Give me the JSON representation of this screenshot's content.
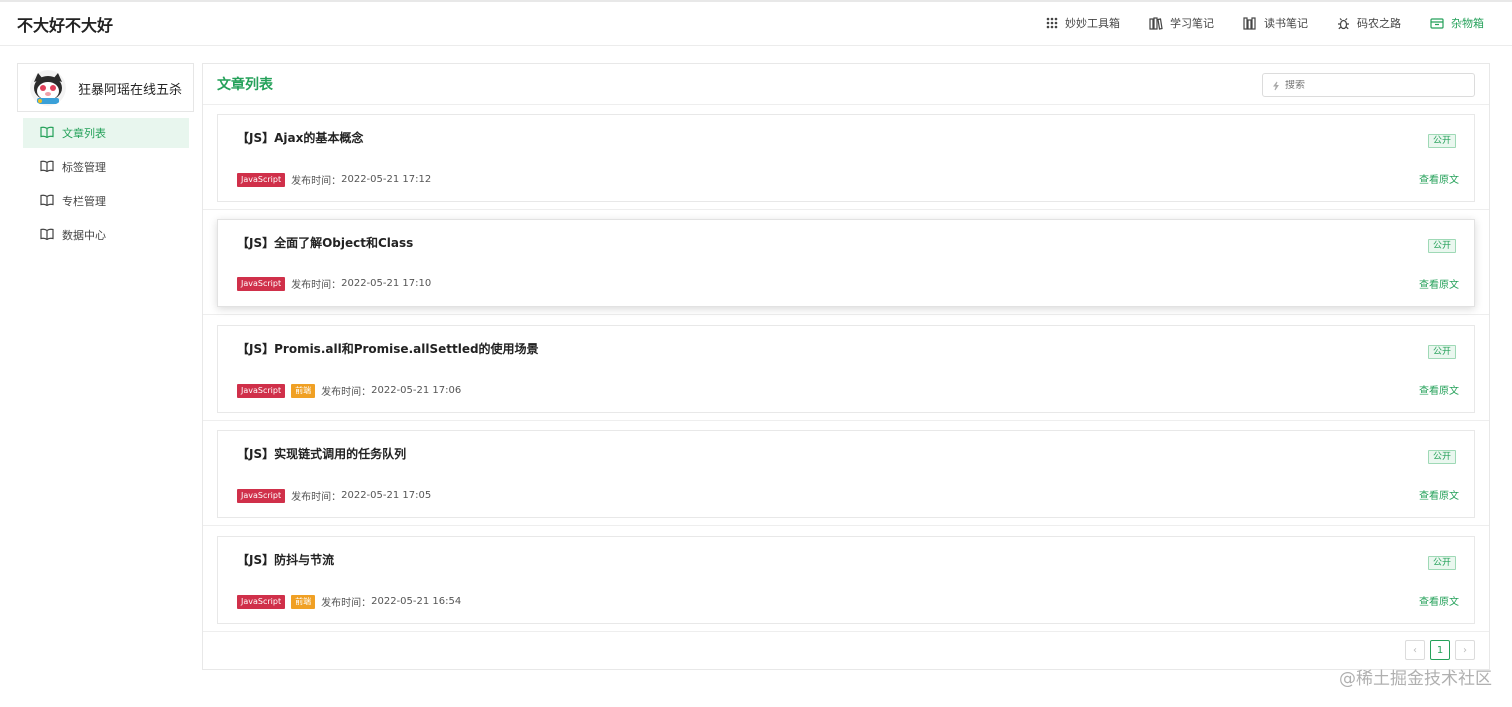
{
  "site": {
    "title": "不大好不大好"
  },
  "nav": [
    {
      "label": "妙妙工具箱",
      "icon": "grid-icon"
    },
    {
      "label": "学习笔记",
      "icon": "books-icon"
    },
    {
      "label": "读书笔记",
      "icon": "bookshelf-icon"
    },
    {
      "label": "码农之路",
      "icon": "bug-icon"
    },
    {
      "label": "杂物箱",
      "icon": "box-icon",
      "active": true
    }
  ],
  "profile": {
    "name": "狂暴阿瑶在线五杀"
  },
  "sidebar": {
    "items": [
      {
        "label": "文章列表",
        "icon": "open-book-icon",
        "active": true
      },
      {
        "label": "标签管理",
        "icon": "open-book-icon"
      },
      {
        "label": "专栏管理",
        "icon": "open-book-icon"
      },
      {
        "label": "数据中心",
        "icon": "open-book-icon"
      }
    ]
  },
  "main": {
    "title": "文章列表",
    "search_placeholder": "搜索"
  },
  "articles": [
    {
      "title": "【JS】Ajax的基本概念",
      "tags": [
        "JavaScript"
      ],
      "time_label": "发布时间：",
      "time": "2022-05-21 17:12",
      "status": "公开",
      "link": "查看原文"
    },
    {
      "title": "【JS】全面了解Object和Class",
      "tags": [
        "JavaScript"
      ],
      "time_label": "发布时间：",
      "time": "2022-05-21 17:10",
      "status": "公开",
      "link": "查看原文"
    },
    {
      "title": "【JS】Promis.all和Promise.allSettled的使用场景",
      "tags": [
        "JavaScript",
        "前端"
      ],
      "time_label": "发布时间：",
      "time": "2022-05-21 17:06",
      "status": "公开",
      "link": "查看原文"
    },
    {
      "title": "【JS】实现链式调用的任务队列",
      "tags": [
        "JavaScript"
      ],
      "time_label": "发布时间：",
      "time": "2022-05-21 17:05",
      "status": "公开",
      "link": "查看原文"
    },
    {
      "title": "【JS】防抖与节流",
      "tags": [
        "JavaScript",
        "前端"
      ],
      "time_label": "发布时间：",
      "time": "2022-05-21 16:54",
      "status": "公开",
      "link": "查看原文"
    }
  ],
  "pagination": {
    "prev": "‹",
    "current": "1",
    "next": "›"
  },
  "watermark": "@稀土掘金技术社区",
  "colors": {
    "accent": "#25a15a",
    "tag_javascript": "#d0304a",
    "tag_frontend": "#f0a024"
  }
}
